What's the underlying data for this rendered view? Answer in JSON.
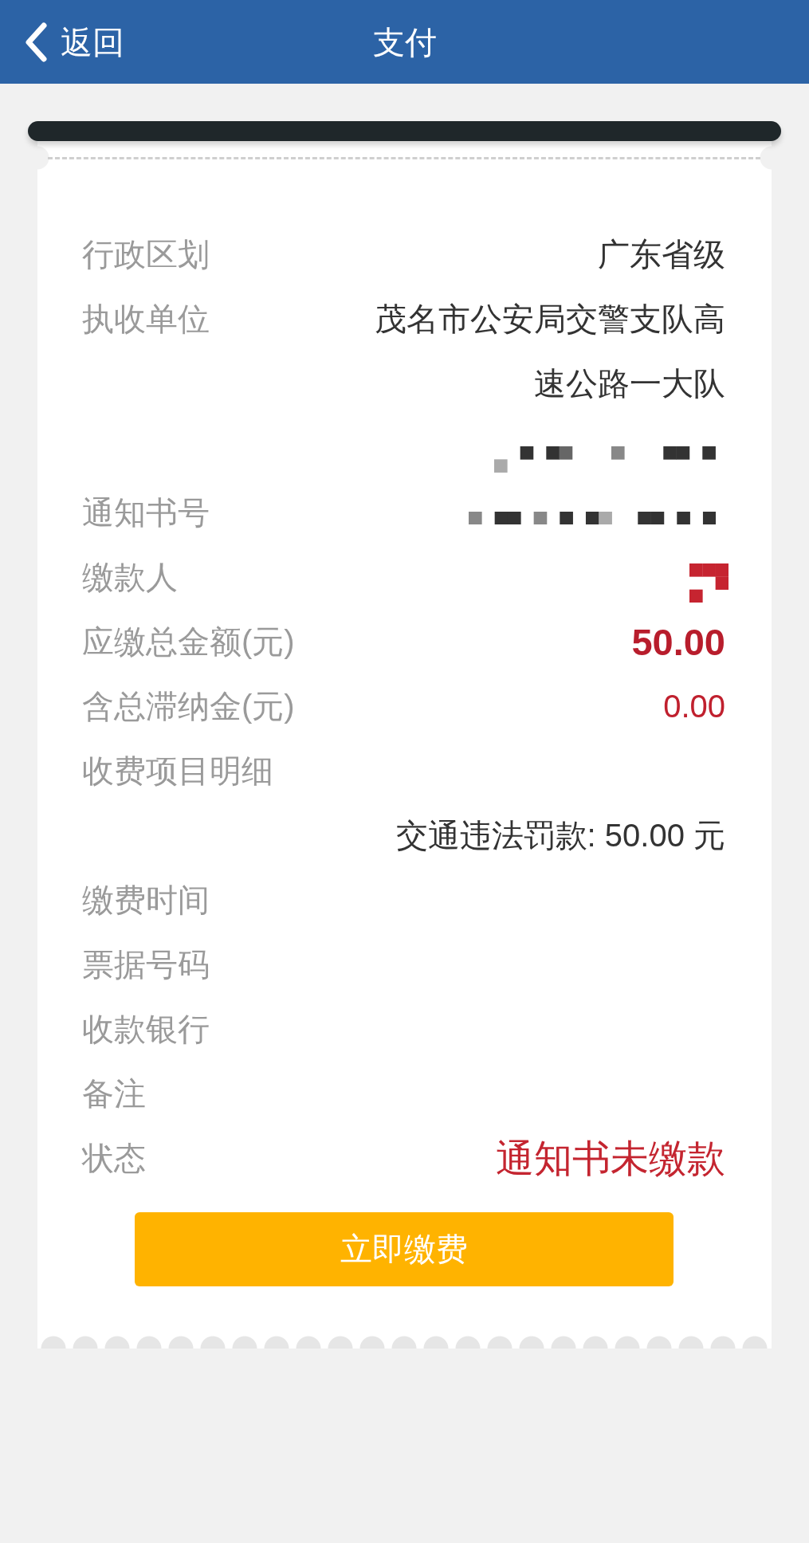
{
  "header": {
    "back_label": "返回",
    "title": "支付"
  },
  "receipt": {
    "rows": [
      {
        "kind": "plain",
        "label": "行政区划",
        "value": "广东省级"
      },
      {
        "kind": "plain",
        "label": "执收单位",
        "value": "茂名市公安局交警支队高速公路一大队"
      },
      {
        "kind": "redacted"
      },
      {
        "kind": "redacted",
        "label": "通知书号"
      },
      {
        "kind": "redacted",
        "label": "缴款人",
        "color": "#c62430"
      },
      {
        "kind": "amount",
        "label": "应缴总金额(元)",
        "value": "50.00"
      },
      {
        "kind": "fee",
        "label": "含总滞纳金(元)",
        "value": "0.00"
      },
      {
        "kind": "plain",
        "label": "收费项目明细"
      },
      {
        "kind": "plain",
        "value": "交通违法罚款: 50.00 元"
      },
      {
        "kind": "plain",
        "label": "缴费时间"
      },
      {
        "kind": "plain",
        "label": "票据号码"
      },
      {
        "kind": "plain",
        "label": "收款银行"
      },
      {
        "kind": "plain",
        "label": "备注"
      },
      {
        "kind": "status",
        "label": "状态",
        "value": "通知书未缴款"
      }
    ]
  },
  "pay_button": {
    "label": "立即缴费"
  }
}
